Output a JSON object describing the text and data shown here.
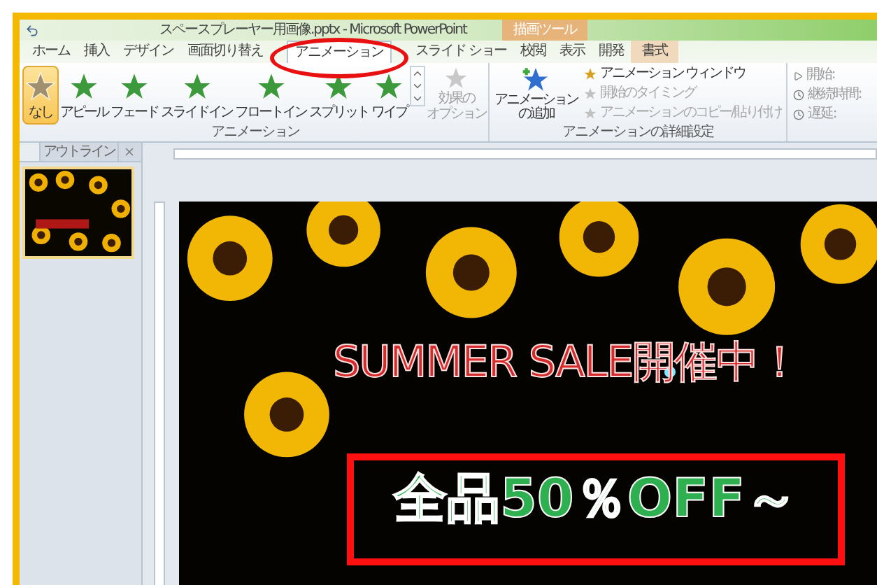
{
  "window": {
    "title": "スペースプレーヤー用画像.pptx - Microsoft PowerPoint"
  },
  "tabs": [
    {
      "label": "ホーム",
      "selected": false
    },
    {
      "label": "挿入",
      "selected": false
    },
    {
      "label": "デザイン",
      "selected": false
    },
    {
      "label": "画面切り替え",
      "selected": false
    },
    {
      "label": "アニメーション",
      "selected": true
    },
    {
      "label": "スライド ショー",
      "selected": false
    },
    {
      "label": "校閲",
      "selected": false
    },
    {
      "label": "表示",
      "selected": false
    },
    {
      "label": "開発",
      "selected": false
    }
  ],
  "contextual_tab": {
    "group": "描画ツール",
    "label": "書式",
    "selected": false
  },
  "animation_gallery": {
    "group_label": "アニメーション",
    "items": [
      {
        "label": "なし",
        "selected": true
      },
      {
        "label": "アピール",
        "selected": false
      },
      {
        "label": "フェード",
        "selected": false
      },
      {
        "label": "スライドイン",
        "selected": false
      },
      {
        "label": "フロートイン",
        "selected": false
      },
      {
        "label": "スプリット",
        "selected": false
      },
      {
        "label": "ワイプ",
        "selected": false
      }
    ]
  },
  "effect_options": {
    "lines": [
      "効果の",
      "オプション"
    ],
    "disabled": true
  },
  "advanced": {
    "group_label": "アニメーションの詳細設定",
    "add_button": [
      "アニメーション",
      "の追加"
    ],
    "commands": [
      {
        "label": "アニメーション ウィンドウ",
        "disabled": false
      },
      {
        "label": "開始のタイミング",
        "disabled": true
      },
      {
        "label": "アニメーションのコピー/貼り付け",
        "disabled": true
      }
    ]
  },
  "timing": {
    "fields": [
      {
        "label": "開始:"
      },
      {
        "label": "継続時間:"
      },
      {
        "label": "遅延:"
      }
    ]
  },
  "pane": {
    "tab": "アウトライン"
  },
  "slide": {
    "title": "SUMMER SALE開催中！",
    "subtitle": "全品50％OFF～"
  }
}
